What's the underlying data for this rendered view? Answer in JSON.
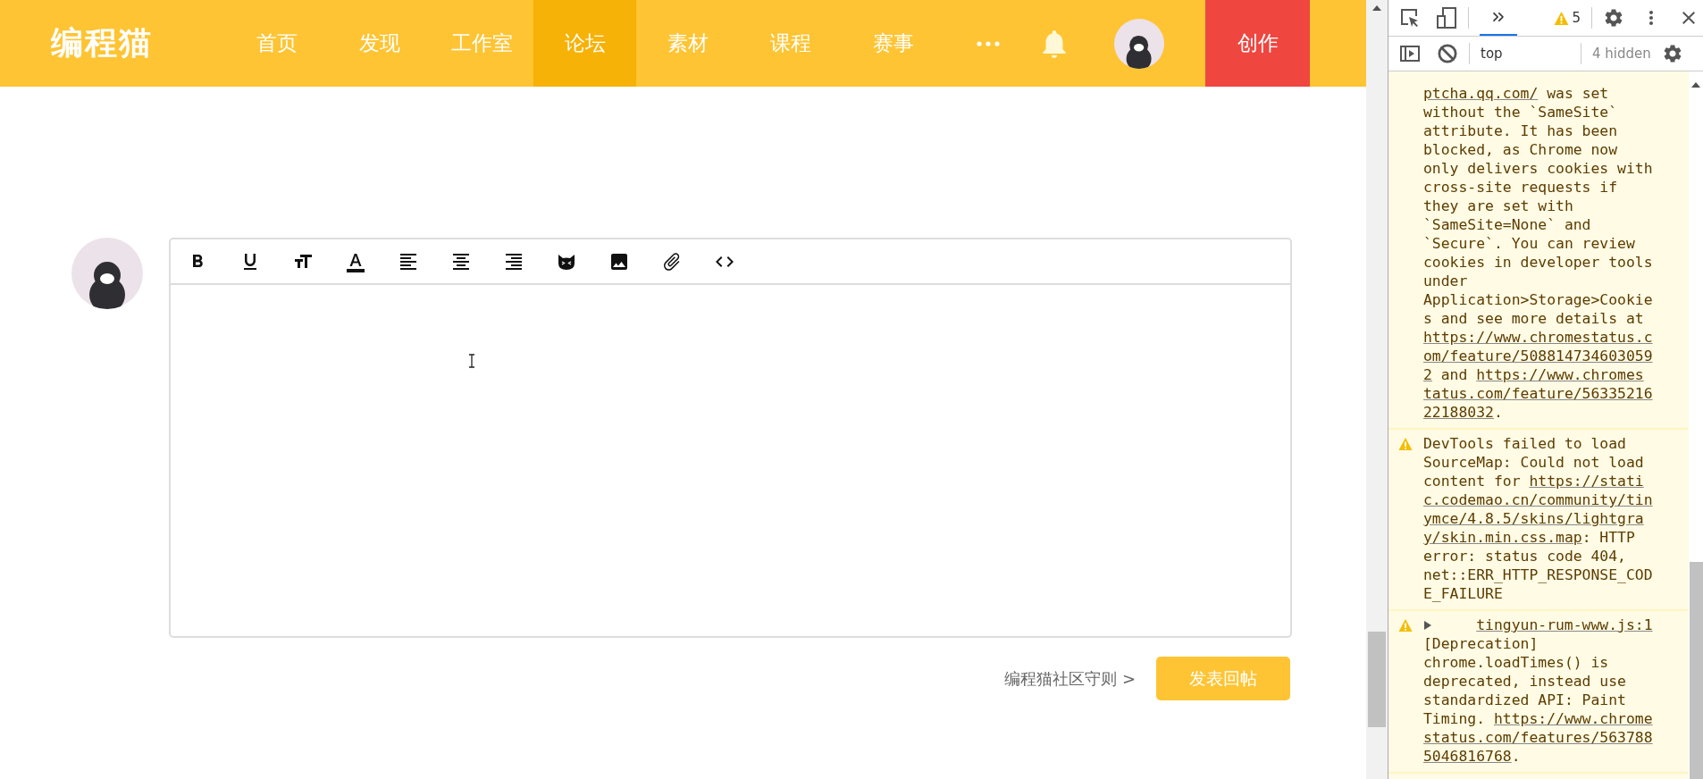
{
  "nav": {
    "logo": "编程猫",
    "items": [
      {
        "label": "首页",
        "selected": false
      },
      {
        "label": "发现",
        "selected": false
      },
      {
        "label": "工作室",
        "selected": false
      },
      {
        "label": "论坛",
        "selected": true
      },
      {
        "label": "素材",
        "selected": false
      },
      {
        "label": "课程",
        "selected": false
      },
      {
        "label": "赛事",
        "selected": false
      }
    ],
    "create_button": "创作"
  },
  "editor": {
    "rules_link": "编程猫社区守则 >",
    "submit_button": "发表回帖"
  },
  "devtools": {
    "warning_count": "5",
    "context": "top",
    "hidden": "4 hidden",
    "messages": [
      {
        "kind": "plain",
        "segments": [
          {
            "kind": "link",
            "text": "ptcha.qq.com/"
          },
          {
            "kind": "text",
            "text": " was set without the `SameSite` attribute. It has been blocked, as Chrome now only delivers cookies with cross-site requests if they are set with `SameSite=None` and `Secure`. You can review cookies in developer tools under Application>Storage>Cookies and see more details at "
          },
          {
            "kind": "link",
            "text": "https://www.chromestatus.com/feature/5088147346030592"
          },
          {
            "kind": "text",
            "text": " and "
          },
          {
            "kind": "link",
            "text": "https://www.chromestatus.com/feature/5633521622188032"
          },
          {
            "kind": "text",
            "text": "."
          }
        ]
      },
      {
        "kind": "warning",
        "segments": [
          {
            "kind": "text",
            "text": "DevTools failed to load SourceMap: Could not load content for "
          },
          {
            "kind": "link",
            "text": "https://static.codemao.cn/community/tinymce/4.8.5/skins/lightgray/skin.min.css.map"
          },
          {
            "kind": "text",
            "text": ": HTTP error: status code 404, net::ERR_HTTP_RESPONSE_CODE_FAILURE"
          }
        ]
      },
      {
        "kind": "warning",
        "source": "tingyun-rum-www.js:1",
        "segments": [
          {
            "kind": "text",
            "text": "[Deprecation] chrome.loadTimes() is deprecated, instead use standardized API: Paint Timing. "
          },
          {
            "kind": "link",
            "text": "https://www.chromestatus.com/features/5637885046816768"
          },
          {
            "kind": "text",
            "text": "."
          }
        ]
      }
    ]
  }
}
